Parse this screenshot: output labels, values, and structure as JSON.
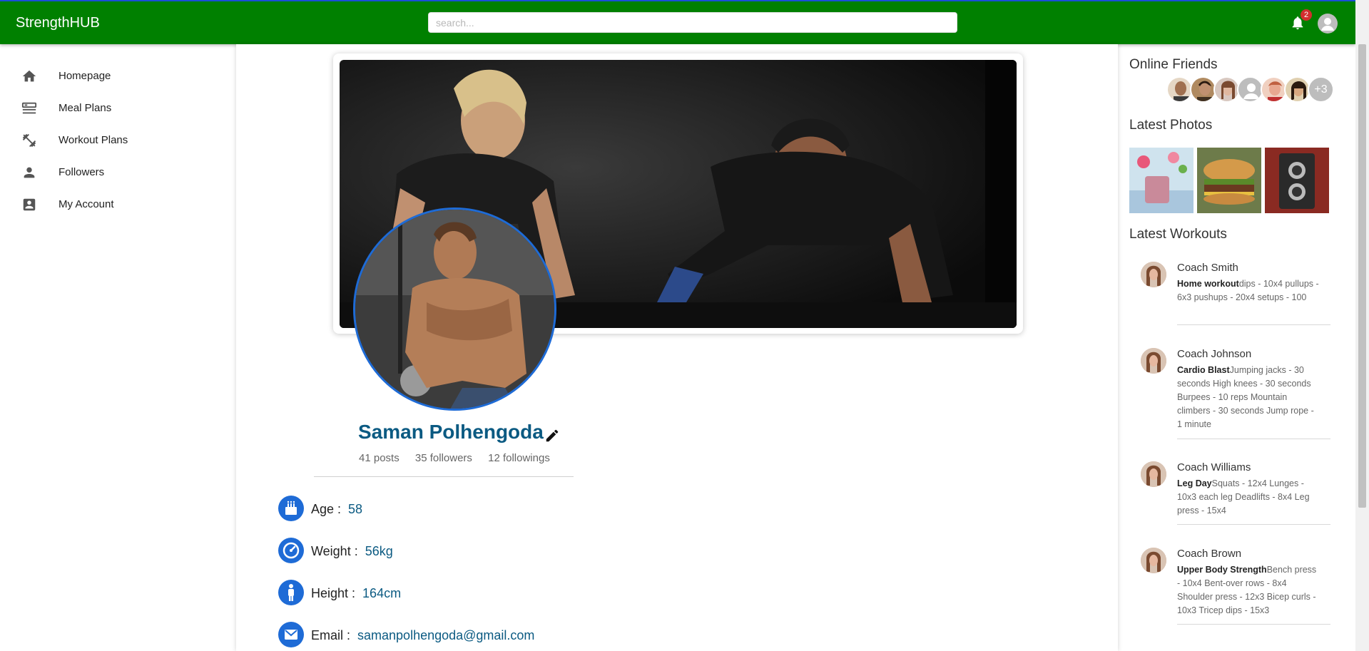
{
  "app": {
    "brand": "StrengthHUB",
    "accent": "#008000"
  },
  "search": {
    "placeholder": "search...",
    "value": ""
  },
  "notifications": {
    "count": "2"
  },
  "nav": {
    "items": [
      {
        "label": "Homepage",
        "icon": "home-icon"
      },
      {
        "label": "Meal Plans",
        "icon": "meal-icon"
      },
      {
        "label": "Workout Plans",
        "icon": "fitness-icon"
      },
      {
        "label": "Followers",
        "icon": "person-icon"
      },
      {
        "label": "My Account",
        "icon": "account-box-icon"
      }
    ]
  },
  "profile": {
    "name": "Saman Polhengoda",
    "posts": "41 posts",
    "followers": "35 followers",
    "followings": "12 followings",
    "info": [
      {
        "label": "Age :",
        "value": "58",
        "icon": "cake-icon"
      },
      {
        "label": "Weight :",
        "value": "56kg",
        "icon": "speed-icon"
      },
      {
        "label": "Height :",
        "value": "164cm",
        "icon": "person-standing-icon"
      },
      {
        "label": "Email :",
        "value": "samanpolhengoda@gmail.com",
        "icon": "mail-icon"
      }
    ]
  },
  "sidebar": {
    "online_title": "Online Friends",
    "more_friends": "+3",
    "photos_title": "Latest Photos",
    "workouts_title": "Latest Workouts",
    "workouts": [
      {
        "coach": "Coach Smith",
        "title": "Home workout",
        "detail": "dips - 10x4 pullups - 6x3 pushups - 20x4 setups - 100"
      },
      {
        "coach": "Coach Johnson",
        "title": "Cardio Blast",
        "detail": "Jumping jacks - 30 seconds High knees - 30 seconds Burpees - 10 reps Mountain climbers - 30 seconds Jump rope - 1 minute"
      },
      {
        "coach": "Coach Williams",
        "title": "Leg Day",
        "detail": "Squats - 12x4 Lunges - 10x3 each leg Deadlifts - 8x4 Leg press - 15x4"
      },
      {
        "coach": "Coach Brown",
        "title": "Upper Body Strength",
        "detail": "Bench press - 10x4 Bent-over rows - 8x4 Shoulder press - 12x3 Bicep curls - 10x3 Tricep dips - 15x3"
      }
    ]
  }
}
